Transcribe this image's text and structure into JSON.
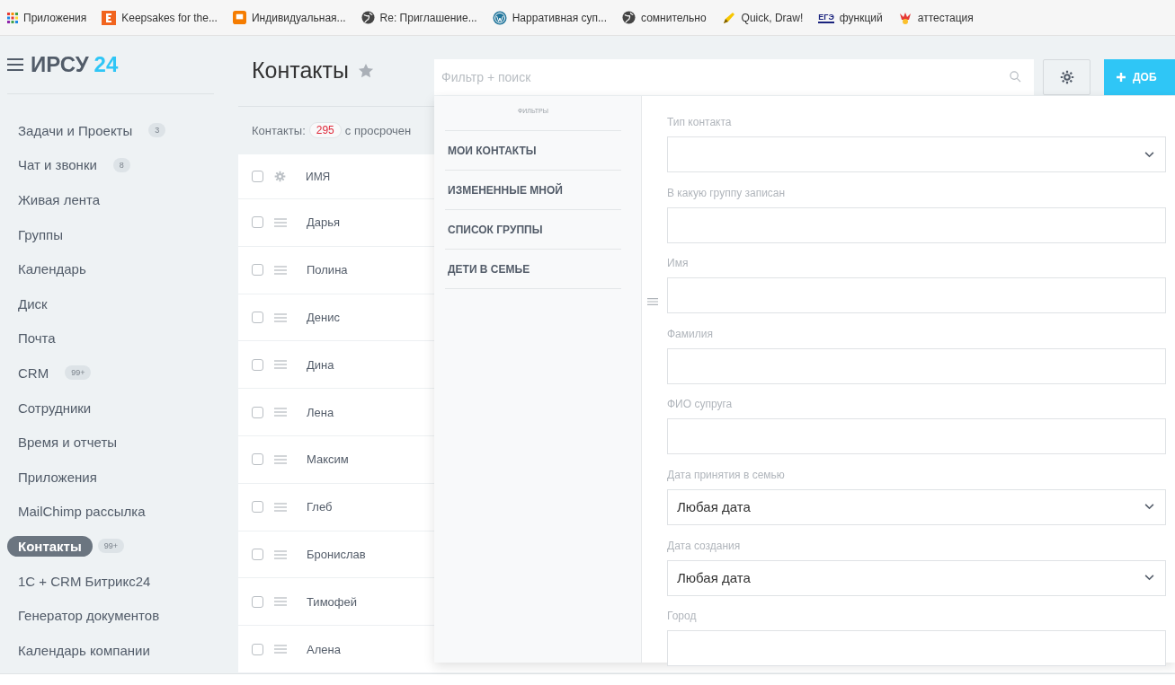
{
  "bookmarks": [
    {
      "label": "Приложения"
    },
    {
      "label": "Keepsakes for the..."
    },
    {
      "label": "Индивидуальная..."
    },
    {
      "label": "Re: Приглашение..."
    },
    {
      "label": "Нарративная суп..."
    },
    {
      "label": "сомнительно"
    },
    {
      "label": "Quick, Draw!"
    },
    {
      "icon_text": "ЕГЭ",
      "label": "функций"
    },
    {
      "label": "аттестация"
    }
  ],
  "logo": {
    "name": "ИРСУ",
    "number": "24"
  },
  "sidebar": {
    "items": [
      {
        "label": "Задачи и Проекты",
        "badge": "3",
        "selected": false
      },
      {
        "label": "Чат и звонки",
        "badge": "8",
        "selected": false
      },
      {
        "label": "Живая лента",
        "selected": false
      },
      {
        "label": "Группы",
        "selected": false
      },
      {
        "label": "Календарь",
        "selected": false
      },
      {
        "label": "Диск",
        "selected": false
      },
      {
        "label": "Почта",
        "selected": false
      },
      {
        "label": "CRM",
        "badge": "99+",
        "selected": false
      },
      {
        "label": "Сотрудники",
        "selected": false
      },
      {
        "label": "Время и отчеты",
        "selected": false
      },
      {
        "label": "Приложения",
        "selected": false
      },
      {
        "label": "MailChimp рассылка",
        "selected": false
      },
      {
        "label": "Контакты",
        "badge": "99+",
        "selected": true
      },
      {
        "label": "1С + CRM Битрикс24",
        "selected": false
      },
      {
        "label": "Генератор документов",
        "selected": false
      },
      {
        "label": "Календарь компании",
        "selected": false
      }
    ]
  },
  "page_title": "Контакты",
  "search": {
    "placeholder": "Фильтр + поиск"
  },
  "add_button": "ДОБ",
  "counter": {
    "label": "Контакты:",
    "count": "295",
    "suffix": "с просрочен"
  },
  "table": {
    "header": {
      "checked": false,
      "column": "ИМЯ"
    },
    "rows": [
      {
        "name": "Дарья",
        "checked": false
      },
      {
        "name": "Полина",
        "checked": false
      },
      {
        "name": "Денис",
        "checked": false
      },
      {
        "name": "Дина",
        "checked": false
      },
      {
        "name": "Лена",
        "checked": false
      },
      {
        "name": "Максим",
        "checked": false
      },
      {
        "name": "Глеб",
        "checked": false
      },
      {
        "name": "Бронислав",
        "checked": false
      },
      {
        "name": "Тимофей",
        "checked": false
      },
      {
        "name": "Алена",
        "checked": false
      }
    ]
  },
  "filter_panel": {
    "heading": "ФИЛЬТРЫ",
    "presets": [
      "МОИ КОНТАКТЫ",
      "ИЗМЕНЕННЫЕ МНОЙ",
      "СПИСОК ГРУППЫ",
      "ДЕТИ В СЕМЬЕ"
    ],
    "fields": [
      {
        "label": "Тип контакта",
        "kind": "select"
      },
      {
        "label": "В какую группу записан",
        "kind": "text"
      },
      {
        "label": "Имя",
        "kind": "text"
      },
      {
        "label": "Фамилия",
        "kind": "text"
      },
      {
        "label": "ФИО супруга",
        "kind": "text"
      },
      {
        "label": "Дата принятия в семью",
        "kind": "select",
        "value": "Любая дата"
      },
      {
        "label": "Дата создания",
        "kind": "select",
        "value": "Любая дата"
      },
      {
        "label": "Город",
        "kind": "text"
      }
    ]
  }
}
